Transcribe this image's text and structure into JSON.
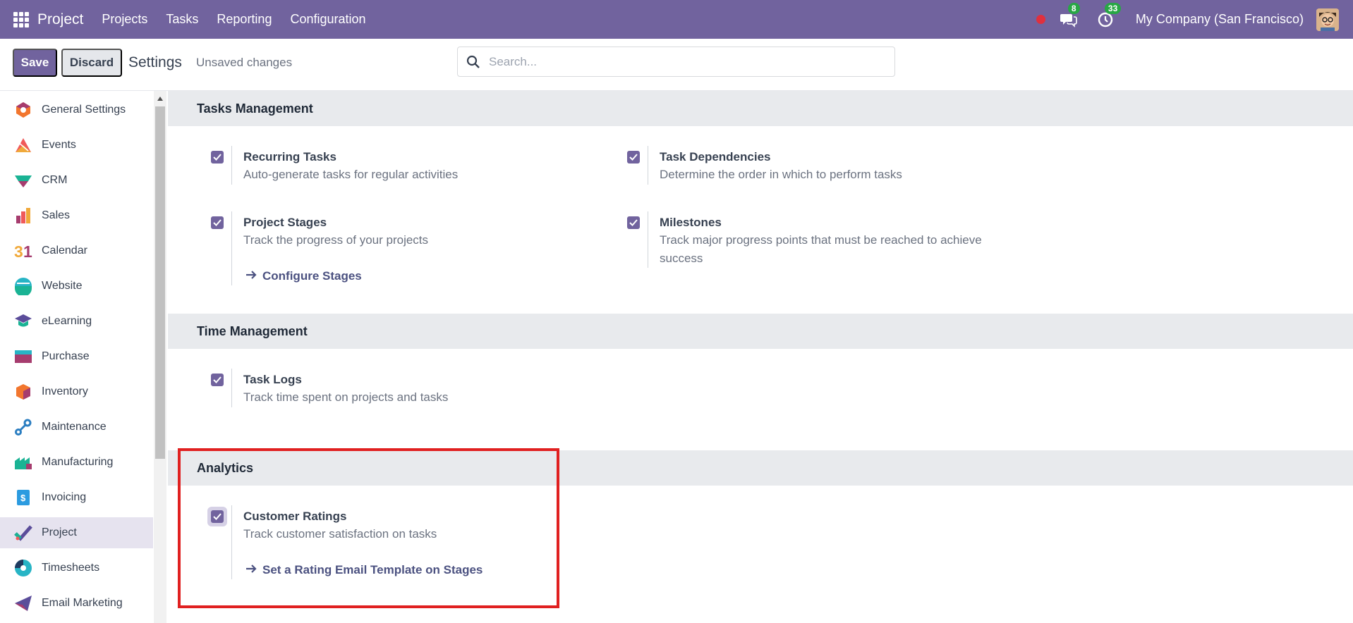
{
  "navbar": {
    "app_name": "Project",
    "menu": [
      "Projects",
      "Tasks",
      "Reporting",
      "Configuration"
    ],
    "messages_count": "8",
    "activities_count": "33",
    "company": "My Company (San Francisco)"
  },
  "control_panel": {
    "save_label": "Save",
    "discard_label": "Discard",
    "title": "Settings",
    "status": "Unsaved changes",
    "search_placeholder": "Search..."
  },
  "sidebar": {
    "items": [
      {
        "label": "General Settings",
        "icon": "general-settings-icon",
        "color": "#f2762e"
      },
      {
        "label": "Events",
        "icon": "events-icon",
        "color": "#f05a5a"
      },
      {
        "label": "CRM",
        "icon": "crm-icon",
        "color": "#1ab394"
      },
      {
        "label": "Sales",
        "icon": "sales-icon",
        "color": "#f0a93a"
      },
      {
        "label": "Calendar",
        "icon": "calendar-icon",
        "color": "#f0a93a"
      },
      {
        "label": "Website",
        "icon": "website-icon",
        "color": "#27b4c5"
      },
      {
        "label": "eLearning",
        "icon": "elearning-icon",
        "color": "#1ab394"
      },
      {
        "label": "Purchase",
        "icon": "purchase-icon",
        "color": "#a63c6e"
      },
      {
        "label": "Inventory",
        "icon": "inventory-icon",
        "color": "#f2762e"
      },
      {
        "label": "Maintenance",
        "icon": "maintenance-icon",
        "color": "#2b7ec1"
      },
      {
        "label": "Manufacturing",
        "icon": "manufacturing-icon",
        "color": "#1ab394"
      },
      {
        "label": "Invoicing",
        "icon": "invoicing-icon",
        "color": "#2b9be0"
      },
      {
        "label": "Project",
        "icon": "project-icon",
        "color": "#5b4d9a",
        "active": true
      },
      {
        "label": "Timesheets",
        "icon": "timesheets-icon",
        "color": "#27b4c5"
      },
      {
        "label": "Email Marketing",
        "icon": "email-marketing-icon",
        "color": "#5b4d9a"
      }
    ]
  },
  "sections": {
    "tasks_management": {
      "title": "Tasks Management",
      "recurring": {
        "title": "Recurring Tasks",
        "desc": "Auto-generate tasks for regular activities",
        "checked": true
      },
      "dependencies": {
        "title": "Task Dependencies",
        "desc": "Determine the order in which to perform tasks",
        "checked": true
      },
      "stages": {
        "title": "Project Stages",
        "desc": "Track the progress of your projects",
        "link": "Configure Stages",
        "checked": true
      },
      "milestones": {
        "title": "Milestones",
        "desc": "Track major progress points that must be reached to achieve success",
        "checked": true
      }
    },
    "time_management": {
      "title": "Time Management",
      "task_logs": {
        "title": "Task Logs",
        "desc": "Track time spent on projects and tasks",
        "checked": true
      }
    },
    "analytics": {
      "title": "Analytics",
      "ratings": {
        "title": "Customer Ratings",
        "desc": "Track customer satisfaction on tasks",
        "link": "Set a Rating Email Template on Stages",
        "checked": true
      }
    }
  },
  "colors": {
    "brand": "#71639e",
    "highlight": "#e02020"
  }
}
